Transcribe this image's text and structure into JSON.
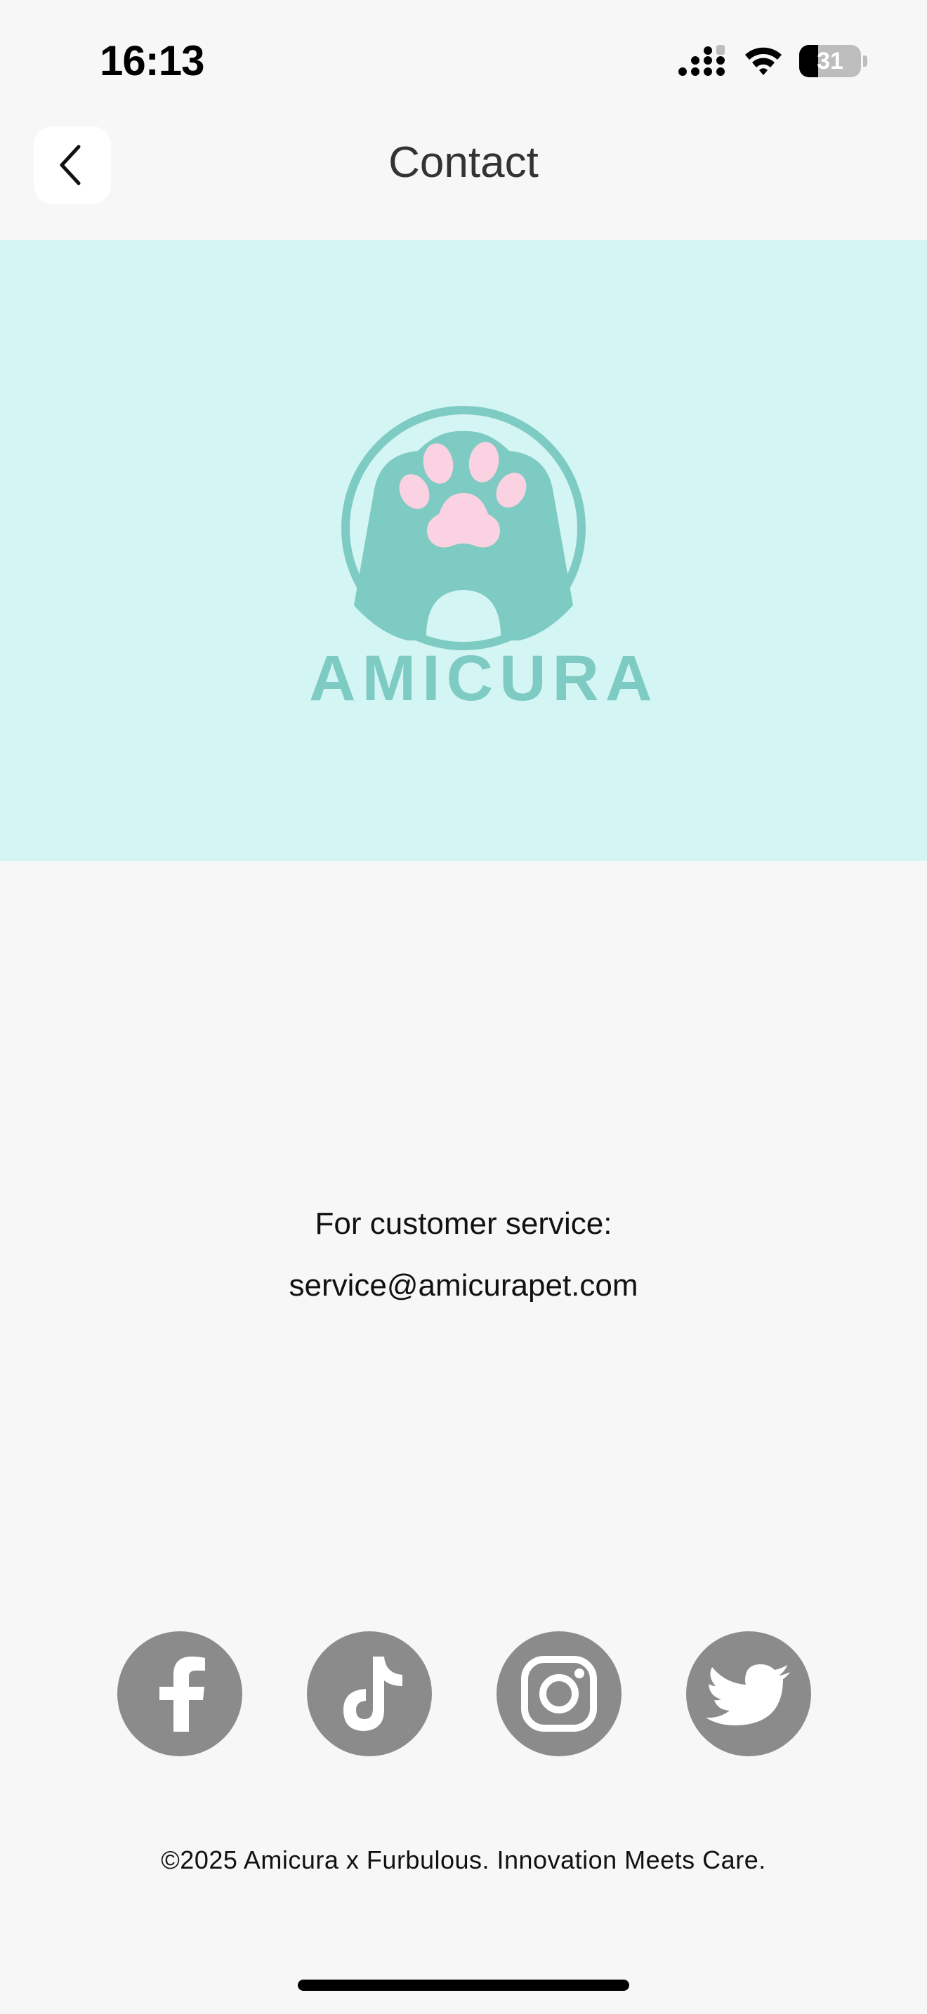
{
  "status_bar": {
    "time": "16:13",
    "battery_level": "31",
    "battery_fraction": 0.31,
    "icons": [
      "signal-icon",
      "wifi-icon",
      "battery-icon"
    ]
  },
  "nav": {
    "title": "Contact",
    "back_icon": "chevron-left-icon"
  },
  "hero": {
    "background": "#d3f5f3",
    "logo_color": "#7ecbc4",
    "paw_color": "#fad2e1",
    "brand_name": "AMICURA"
  },
  "contact": {
    "label": "For customer service:",
    "email": "service@amicurapet.com"
  },
  "social": [
    {
      "name": "facebook",
      "icon": "facebook-icon"
    },
    {
      "name": "tiktok",
      "icon": "tiktok-icon"
    },
    {
      "name": "instagram",
      "icon": "instagram-icon"
    },
    {
      "name": "twitter",
      "icon": "twitter-icon"
    }
  ],
  "footer": {
    "copyright": "©2025 Amicura x Furbulous. Innovation Meets Care."
  },
  "colors": {
    "page_background": "#f7f7f7",
    "social_icon_background": "#8b8b8b"
  }
}
